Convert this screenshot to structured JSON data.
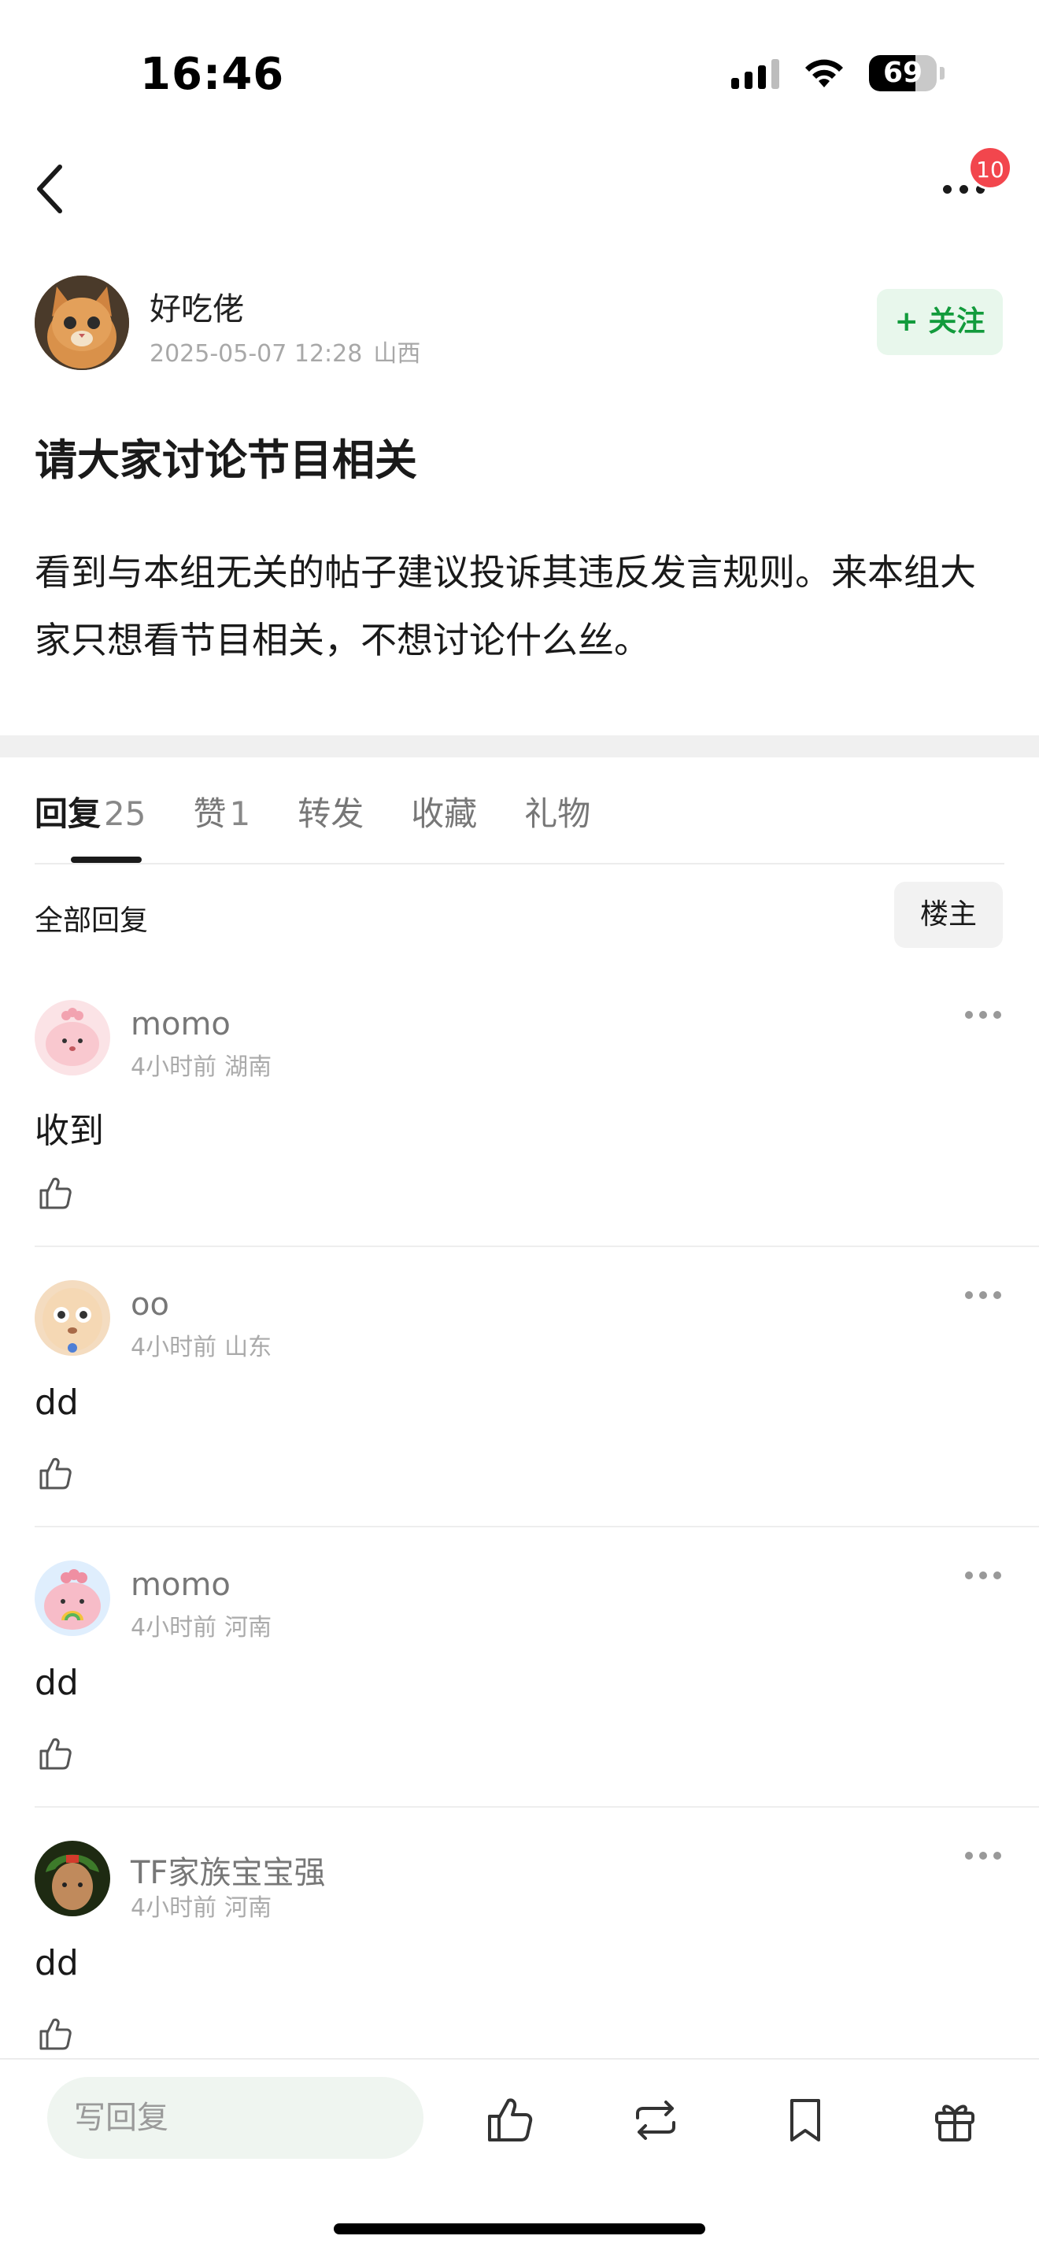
{
  "status_bar": {
    "time": "16:46",
    "battery": "69",
    "battery_level": 0.69
  },
  "nav": {
    "badge_count": "10"
  },
  "author": {
    "name": "好吃佬",
    "date": "2025-05-07 12:28",
    "location": "山西",
    "follow_label": "+ 关注"
  },
  "post": {
    "title": "请大家讨论节目相关",
    "body": "看到与本组无关的帖子建议投诉其违反发言规则。来本组大家只想看节目相关，不想讨论什么丝。"
  },
  "tabs": [
    {
      "label": "回复",
      "count": "25"
    },
    {
      "label": "赞",
      "count": "1"
    },
    {
      "label": "转发",
      "count": ""
    },
    {
      "label": "收藏",
      "count": ""
    },
    {
      "label": "礼物",
      "count": ""
    }
  ],
  "filter": {
    "all_replies": "全部回复",
    "owner_only": "楼主"
  },
  "comments": [
    {
      "name": "momo",
      "time": "4小时前",
      "location": "湖南",
      "text": "收到"
    },
    {
      "name": "oo",
      "time": "4小时前",
      "location": "山东",
      "text": "dd"
    },
    {
      "name": "momo",
      "time": "4小时前",
      "location": "河南",
      "text": "dd"
    },
    {
      "name": "TF家族宝宝强",
      "time": "4小时前",
      "location": "河南",
      "text": "dd"
    }
  ],
  "bottom_bar": {
    "reply_placeholder": "写回复"
  },
  "icons": [
    "back-icon",
    "more-icon",
    "like-icon",
    "repost-icon",
    "bookmark-icon",
    "gift-icon"
  ],
  "colors": {
    "follow_green": "#129b3c",
    "follow_bg": "#e8f7ec",
    "badge_red": "#f2464d"
  }
}
